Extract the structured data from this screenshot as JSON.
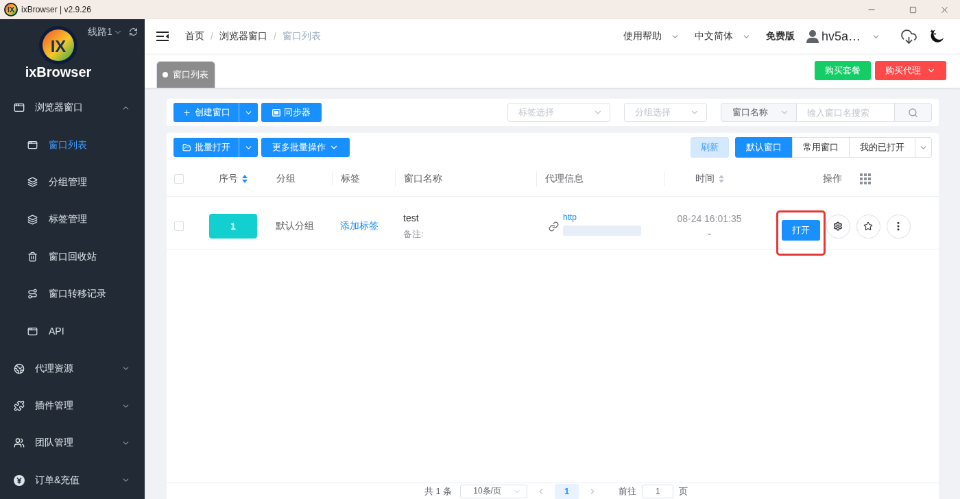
{
  "window": {
    "logo_text": "IX",
    "title": "ixBrowser | v2.9.26"
  },
  "sidebar": {
    "logo_text": "IX",
    "brand": "ixBrowser",
    "route": "线路1",
    "items": [
      {
        "label": "浏览器窗口",
        "expanded": true,
        "selected": false,
        "children": [
          {
            "label": "窗口列表",
            "selected": true
          },
          {
            "label": "分组管理",
            "selected": false
          },
          {
            "label": "标签管理",
            "selected": false
          },
          {
            "label": "窗口回收站",
            "selected": false
          },
          {
            "label": "窗口转移记录",
            "selected": false
          },
          {
            "label": "API",
            "selected": false
          }
        ]
      },
      {
        "label": "代理资源",
        "expanded": false,
        "selected": false
      },
      {
        "label": "插件管理",
        "expanded": false,
        "selected": false
      },
      {
        "label": "团队管理",
        "expanded": false,
        "selected": false
      },
      {
        "label": "订单&充值",
        "expanded": false,
        "selected": false
      }
    ]
  },
  "header": {
    "breadcrumb": {
      "items": [
        "首页",
        "浏览器窗口",
        "窗口列表"
      ],
      "separators": [
        "/",
        "/"
      ]
    },
    "menus": [
      "使用帮助",
      "中文简体"
    ],
    "plan": "免费版",
    "user": "hv5a…"
  },
  "tabs": [
    {
      "label": "窗口列表",
      "selected": true
    }
  ],
  "purchase_buttons": [
    {
      "label": "购买套餐",
      "kind": "success",
      "dropdown": false
    },
    {
      "label": "购买代理",
      "kind": "danger",
      "dropdown": true
    }
  ],
  "toolbar": {
    "create_button": "创建窗口",
    "sync_button": "同步器",
    "tag_select": {
      "placeholder": "标签选择"
    },
    "group_select": {
      "placeholder": "分组选择"
    },
    "search": {
      "field": "窗口名称",
      "placeholder": "输入窗口名搜索"
    }
  },
  "list_toolbar": {
    "batch_open_button": "批量打开",
    "more_batch_button": "更多批量操作",
    "refresh_button": "刷新",
    "views": [
      {
        "label": "默认窗口",
        "selected": true
      },
      {
        "label": "常用窗口",
        "selected": false
      },
      {
        "label": "我的已打开",
        "selected": false
      }
    ]
  },
  "table": {
    "select_all": {
      "checked": false
    },
    "columns": [
      {
        "label": "序号",
        "sortable": true,
        "sorted": true
      },
      {
        "label": "分组"
      },
      {
        "label": "标签"
      },
      {
        "label": "窗口名称"
      },
      {
        "label": "代理信息"
      },
      {
        "label": "时间",
        "sortable": true,
        "sorted": false
      },
      {
        "label": "操作"
      }
    ],
    "rows": [
      {
        "checked": false,
        "number": "1",
        "group": "默认分组",
        "tag_link": "添加标签",
        "name": "test",
        "note_label": "备注:",
        "proxy_type": "http",
        "time": "08-24 16:01:35",
        "time_secondary": "-",
        "open_button": "打开",
        "highlighted": true
      }
    ]
  },
  "pagination": {
    "total": "共 1 条",
    "page_size": "10条/页",
    "prev": {
      "disabled": true
    },
    "pages": [
      {
        "label": "1",
        "selected": true
      }
    ],
    "next": {
      "disabled": true
    },
    "goto_label": "前往",
    "goto_value": "1",
    "goto_suffix": "页"
  }
}
